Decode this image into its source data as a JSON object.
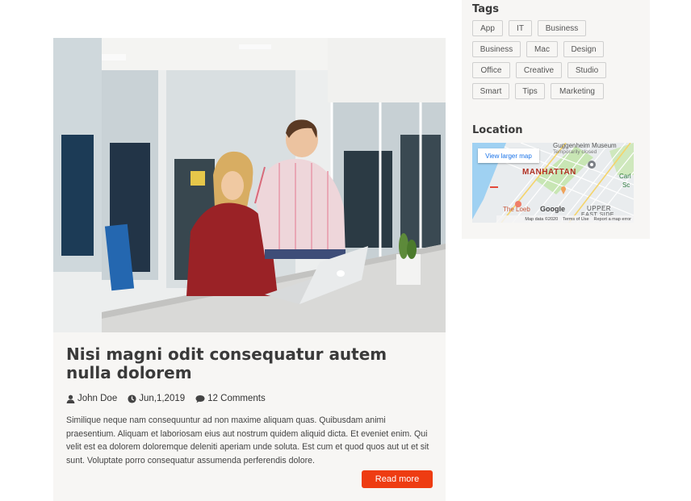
{
  "post": {
    "title": "Nisi magni odit consequatur autem nulla dolorem",
    "author": "John Doe",
    "date": "Jun,1,2019",
    "comments": "12 Comments",
    "excerpt": "Similique neque nam consequuntur ad non maxime aliquam quas. Quibusdam animi praesentium. Aliquam et laboriosam eius aut nostrum quidem aliquid dicta. Et eveniet enim. Qui velit est ea dolorem doloremque deleniti aperiam unde soluta. Est cum et quod quos aut ut et sit sunt. Voluptate porro consequatur assumenda perferendis dolore.",
    "read_more": "Read more",
    "image": "office-laptop-photo"
  },
  "sidebar": {
    "tags_title": "Tags",
    "tags": [
      "App",
      "IT",
      "Business",
      "Business",
      "Mac",
      "Design",
      "Office",
      "Creative",
      "Studio",
      "Smart",
      "Tips",
      "Marketing"
    ],
    "location_title": "Location",
    "map": {
      "view_larger": "View larger map",
      "manhattan": "MANHATTAN",
      "guggenheim": "Guggenheim Museum",
      "temporarily_closed": "Temporarily closed",
      "the_loeb": "The Loeb",
      "upper": "UPPER",
      "east_side": "EAST SIDE",
      "carl": "Carl",
      "sc": "Sc",
      "map_data": "Map data ©2020",
      "terms": "Terms of Use",
      "report": "Report a map error",
      "google": "Google"
    }
  },
  "colors": {
    "accent": "#ee3c12",
    "card_bg": "#f7f6f4",
    "title": "#3a3a3a"
  }
}
